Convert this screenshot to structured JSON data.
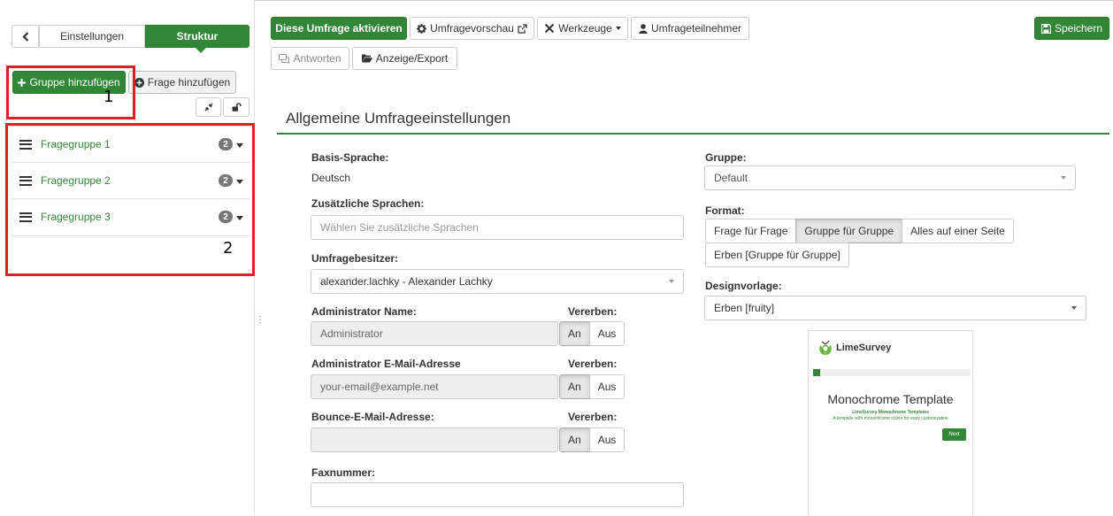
{
  "sidebar": {
    "back_icon": "chevron-left-icon",
    "tab_settings": "Einstellungen",
    "tab_structure": "Struktur",
    "add_group_button": "Gruppe hinzufügen",
    "add_question_button": "Frage hinzufügen",
    "collapse_icon": "collapse-icon",
    "lock_icon": "unlock-icon",
    "groups": [
      {
        "label": "Fragegruppe 1",
        "count": "2"
      },
      {
        "label": "Fragegruppe 2",
        "count": "2"
      },
      {
        "label": "Fragegruppe 3",
        "count": "2"
      }
    ]
  },
  "annotations": {
    "marker_1": "1",
    "marker_2": "2",
    "color": "#e31e24"
  },
  "toolbar": {
    "activate_button": "Diese Umfrage aktivieren",
    "preview_button": "Umfragevorschau",
    "tools_button": "Werkzeuge",
    "participants_button": "Umfrageteilnehmer",
    "save_button": "Speichern",
    "responses_button": "Antworten",
    "display_export_button": "Anzeige/Export"
  },
  "main": {
    "title": "Allgemeine Umfrageeinstellungen",
    "base_language_label": "Basis-Sprache:",
    "base_language_value": "Deutsch",
    "additional_languages_label": "Zusätzliche Sprachen:",
    "additional_languages_placeholder": "Wählen Sie zusätzliche Sprachen",
    "owner_label": "Umfragebesitzer:",
    "owner_value": "alexander.lachky - Alexander Lachky",
    "admin_name_label": "Administrator Name:",
    "admin_name_value": "Administrator",
    "admin_email_label": "Administrator E-Mail-Adresse",
    "admin_email_value": "your-email@example.net",
    "bounce_email_label": "Bounce-E-Mail-Adresse:",
    "bounce_email_value": "",
    "fax_label": "Faxnummer:",
    "fax_value": "",
    "inherit_label": "Vererben:",
    "on_label": "An",
    "off_label": "Aus",
    "group_label": "Gruppe:",
    "group_value": "Default",
    "format_label": "Format:",
    "format_options": [
      "Frage für Frage",
      "Gruppe für Gruppe",
      "Alles auf einer Seite"
    ],
    "format_selected": "Gruppe für Gruppe",
    "format_inherit": "Erben [Gruppe für Gruppe]",
    "template_label": "Designvorlage:",
    "template_value": "Erben [fruity]"
  },
  "template_preview": {
    "logo_text": "LimeSurvey",
    "heading": "Monochrome Template",
    "subheading": "LimeSurvey Monochrome Templates",
    "description": "A template with monochrome colors for easy customization",
    "next_button": "Next"
  },
  "colors": {
    "accent": "#328637",
    "annotation": "#e31e24"
  }
}
